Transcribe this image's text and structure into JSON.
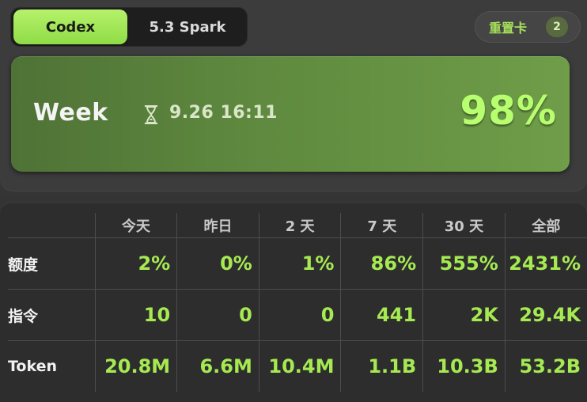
{
  "tabs": [
    {
      "label": "Codex",
      "active": true
    },
    {
      "label": "5.3 Spark",
      "active": false
    }
  ],
  "reset_card": {
    "label": "重置卡",
    "count": "2"
  },
  "week": {
    "title": "Week",
    "reset_time": "9.26 16:11",
    "percent": "98%",
    "icon": "hourglass-icon"
  },
  "stats": {
    "columns": [
      "今天",
      "昨日",
      "2 天",
      "7 天",
      "30 天",
      "全部"
    ],
    "rows": [
      {
        "label": "额度",
        "values": [
          "2%",
          "0%",
          "1%",
          "86%",
          "555%",
          "2431%"
        ]
      },
      {
        "label": "指令",
        "values": [
          "10",
          "0",
          "0",
          "441",
          "2K",
          "29.4K"
        ]
      },
      {
        "label": "Token",
        "values": [
          "20.8M",
          "6.6M",
          "10.4M",
          "1.1B",
          "10.3B",
          "53.2B"
        ]
      }
    ]
  },
  "colors": {
    "accent": "#a6ea52",
    "card_green": "#5f8a3f",
    "background": "#2f2f2f"
  }
}
